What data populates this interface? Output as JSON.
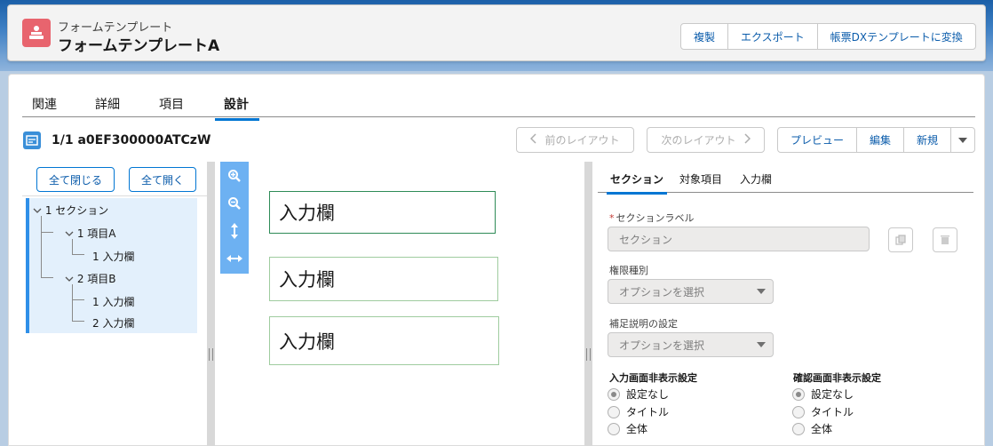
{
  "header": {
    "object_label": "フォームテンプレート",
    "record_title": "フォームテンプレートA",
    "actions": [
      "複製",
      "エクスポート",
      "帳票DXテンプレートに変換"
    ]
  },
  "tabs": [
    "関連",
    "詳細",
    "項目",
    "設計"
  ],
  "active_tab": "設計",
  "record": {
    "title": "1/1 a0EF300000ATCzW"
  },
  "layout_nav": {
    "prev": "前のレイアウト",
    "next": "次のレイアウト"
  },
  "layout_actions": [
    "プレビュー",
    "編集",
    "新規"
  ],
  "tree_panel": {
    "collapse_all": "全て閉じる",
    "expand_all": "全て開く",
    "nodes": [
      "1 セクション",
      "1 項目A",
      "1 入力欄",
      "2 項目B",
      "1 入力欄",
      "2 入力欄"
    ]
  },
  "canvas": {
    "fields": [
      "入力欄",
      "入力欄",
      "入力欄"
    ]
  },
  "props": {
    "tabs": [
      "セクション",
      "対象項目",
      "入力欄"
    ],
    "active_tab": "セクション",
    "section_label": {
      "label": "セクションラベル",
      "required_mark": "*",
      "value": "セクション"
    },
    "permission": {
      "label": "権限種別",
      "placeholder": "オプションを選択"
    },
    "supplement": {
      "label": "補足説明の設定",
      "placeholder": "オプションを選択"
    },
    "input_hide": {
      "title": "入力画面非表示設定",
      "options": [
        "設定なし",
        "タイトル",
        "全体"
      ],
      "selected": "設定なし"
    },
    "confirm_hide": {
      "title": "確認画面非表示設定",
      "options": [
        "設定なし",
        "タイトル",
        "全体"
      ],
      "selected": "設定なし"
    }
  },
  "colors": {
    "brand_blue": "#0176d3",
    "app_icon": "#e8646e",
    "zoom_bar": "#6db1f2"
  },
  "icons": [
    "app-form-icon",
    "record-icon",
    "zoom-in-icon",
    "zoom-out-icon",
    "vertical-resize-icon",
    "horizontal-resize-icon",
    "copy-icon",
    "delete-icon"
  ]
}
